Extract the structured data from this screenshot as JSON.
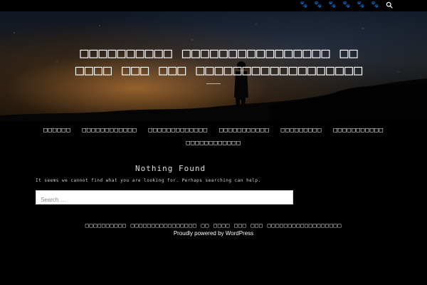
{
  "colors": {
    "background": "#000000",
    "text": "#ffffff",
    "search_background": "#ffffff"
  },
  "header": {
    "site_title": "□□□□□□□□□□ □□□□□□□□□□□□□□□□ □□\n□□□□ □□□ □□□ □□□□□□□□□□□□□□□□□□",
    "icons": [
      {
        "name": "social-icon-1",
        "glyph": "🐾"
      },
      {
        "name": "social-icon-2",
        "glyph": "🐾"
      },
      {
        "name": "social-icon-3",
        "glyph": "🐾"
      },
      {
        "name": "social-icon-4",
        "glyph": "🐾"
      },
      {
        "name": "social-icon-5",
        "glyph": "🐾"
      },
      {
        "name": "social-icon-6",
        "glyph": "🐾"
      }
    ]
  },
  "nav": {
    "items": [
      "□□□□□□",
      "□□□□□□□□□□□□",
      "□□□□□□□□□□□□□",
      "□□□□□□□□□□□",
      "□□□□□□□□□",
      "□□□□□□□□□□□",
      "□□□□□□□□□□□□"
    ]
  },
  "main": {
    "notfound_title": "Nothing Found",
    "notfound_text": "It seems we cannot find what you are looking for. Perhaps searching can help.",
    "search_placeholder": "Search …"
  },
  "footer": {
    "site_line": "□□□□□□□□□□ □□□□□□□□□□□□□□□□ □□ □□□□ □□□ □□□ □□□□□□□□□□□□□□□□□□",
    "powered": "Proudly powered by WordPress"
  }
}
